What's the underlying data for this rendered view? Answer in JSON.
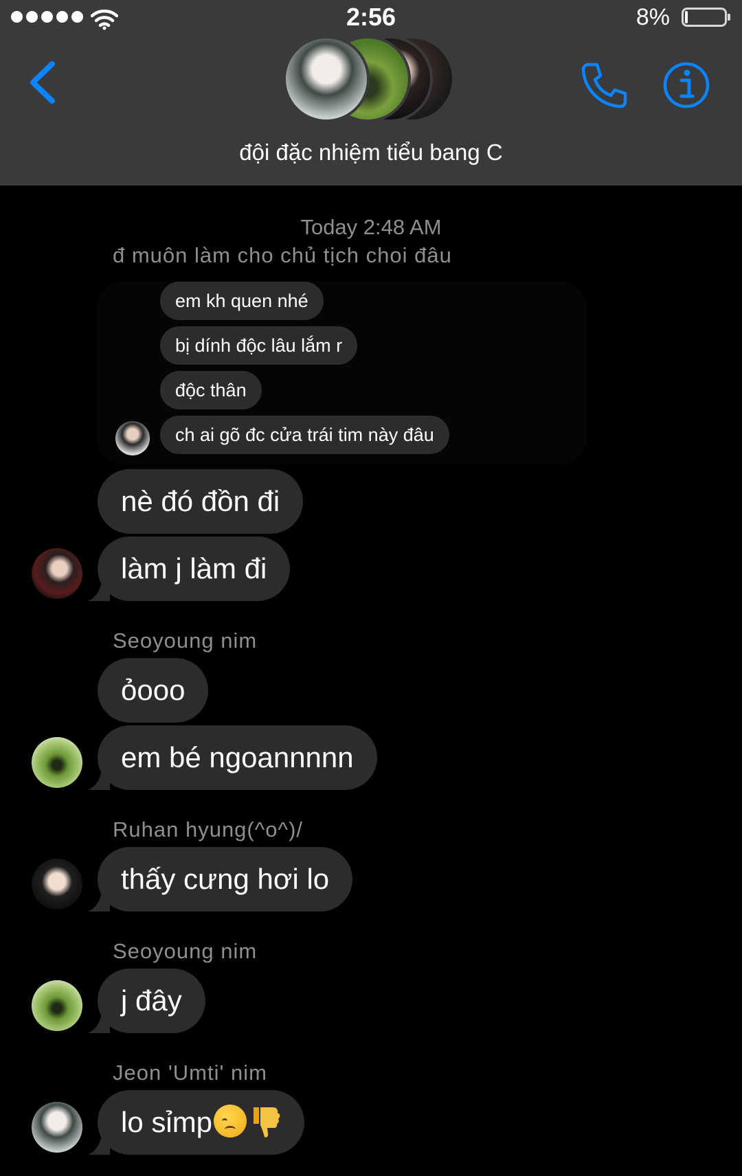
{
  "status_bar": {
    "time": "2:56",
    "battery_percent": "8%",
    "battery_level": 0.08,
    "signal_dots": 5
  },
  "header": {
    "group_name": "đội đặc nhiệm tiểu bang C",
    "accent_color": "#0a84ff"
  },
  "thread": {
    "timestamp": "Today 2:48 AM",
    "reply_context": "đ muôn làm cho chủ tịch choi đâu",
    "quoted_messages": [
      "em kh quen nhé",
      "bị dính độc lâu lắm r",
      "độc thân",
      "ch ai gõ đc cửa trái tim này đâu"
    ],
    "messages": [
      {
        "sender": "",
        "text": "nè đó đồn đi"
      },
      {
        "sender": "",
        "text": "làm j làm đi"
      },
      {
        "sender": "Seoyoung nim",
        "text": "ỏooo"
      },
      {
        "sender": "",
        "text": "em bé ngoannnnn"
      },
      {
        "sender": "Ruhan hyung(^o^)/",
        "text": "thấy cưng hơi lo"
      },
      {
        "sender": "Seoyoung nim",
        "text": "j đây"
      },
      {
        "sender": "Jeon 'Umti' nim",
        "text": "lo sỉmp"
      }
    ]
  }
}
